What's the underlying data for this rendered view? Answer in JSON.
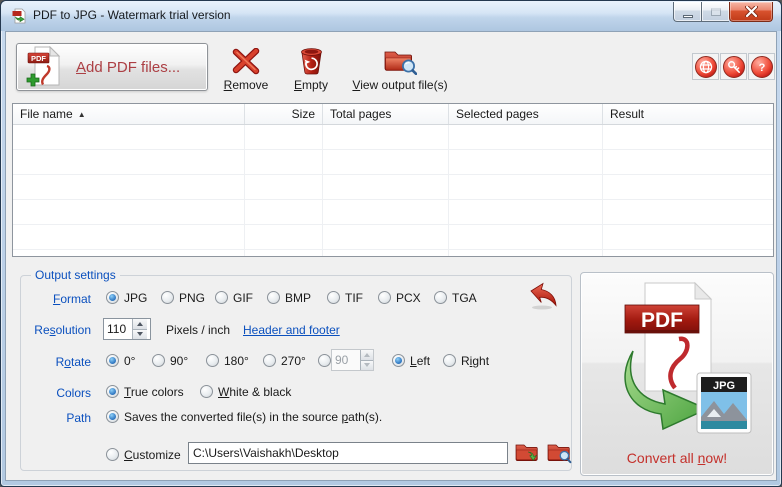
{
  "titlebar": {
    "title": "PDF to JPG - Watermark trial version"
  },
  "toolbar": {
    "add": {
      "pre": "",
      "key": "A",
      "post": "dd PDF files...",
      "pdf_icon_text": "PDF"
    },
    "remove": {
      "pre": "",
      "key": "R",
      "post": "emove"
    },
    "empty": {
      "pre": "",
      "key": "E",
      "post": "mpty"
    },
    "view_output": {
      "pre": "",
      "key": "V",
      "post": "iew output file(s)"
    }
  },
  "table": {
    "columns": {
      "file_name": "File name",
      "sort_indicator": "▲",
      "size": "Size",
      "total_pages": "Total pages",
      "selected_pages": "Selected pages",
      "result": "Result"
    },
    "rows": []
  },
  "settings": {
    "legend": "Output settings",
    "format": {
      "label": {
        "pre": "",
        "key": "F",
        "post": "ormat"
      },
      "options": [
        "JPG",
        "PNG",
        "GIF",
        "BMP",
        "TIF",
        "PCX",
        "TGA"
      ],
      "selected": "JPG"
    },
    "resolution": {
      "label": {
        "pre": "Re",
        "key": "s",
        "post": "olution"
      },
      "value": "110",
      "unit": "Pixels / inch",
      "link": "Header and footer"
    },
    "rotate": {
      "label": {
        "pre": "R",
        "key": "o",
        "post": "tate"
      },
      "options": [
        "0°",
        "90°",
        "180°",
        "270°"
      ],
      "selected": "0°",
      "custom_value": "90",
      "left": {
        "pre": "",
        "key": "L",
        "post": "eft"
      },
      "right": {
        "pre": "R",
        "key": "i",
        "post": "ght"
      },
      "direction_selected": "Left"
    },
    "colors": {
      "label": "Colors",
      "true_colors": {
        "pre": "",
        "key": "T",
        "post": "rue colors"
      },
      "white_black": {
        "pre": "",
        "key": "W",
        "post": "hite & black"
      },
      "selected": "True colors"
    },
    "path": {
      "label": "Path",
      "source_option": {
        "pre": "Saves the converted file(s) in the source ",
        "key": "p",
        "post": "ath(s)."
      },
      "customize_option": {
        "pre": "",
        "key": "C",
        "post": "ustomize"
      },
      "selected": "source",
      "custom_path": "C:\\Users\\Vaishakh\\Desktop"
    }
  },
  "convert": {
    "label": {
      "pre": "Convert all ",
      "key": "n",
      "post": "ow!"
    },
    "pdf_badge": "PDF",
    "jpg_badge": "JPG"
  },
  "colors": {
    "label_blue": "#0b50be",
    "link_blue": "#0b50be",
    "add_text_red": "#ac3f44",
    "convert_text_red": "#c4302b",
    "titlebar_blue": "#c0d5eb"
  }
}
